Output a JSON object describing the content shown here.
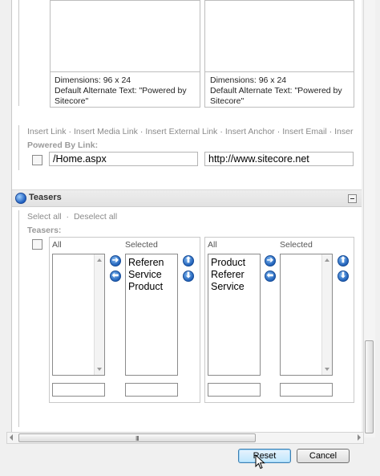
{
  "images": [
    {
      "dimensions": "Dimensions: 96 x 24",
      "alt_line1": "Default Alternate Text: \"Powered by",
      "alt_line2": "Sitecore\""
    },
    {
      "dimensions": "Dimensions: 96 x 24",
      "alt_line1": "Default Alternate Text: \"Powered by",
      "alt_line2": "Sitecore\""
    }
  ],
  "link_toolbar": {
    "items": [
      "Insert Link",
      "Insert Media Link",
      "Insert External Link",
      "Insert Anchor",
      "Insert Email",
      "Inser"
    ],
    "separator": "·"
  },
  "powered_by": {
    "label": "Powered By Link:",
    "path_value": "/Home.aspx",
    "url_value": "http://www.sitecore.net"
  },
  "teasers_section": {
    "title": "Teasers",
    "select_all": "Select all",
    "deselect_all": "Deselect all",
    "field_label": "Teasers:",
    "left_panel": {
      "all_label": "All",
      "selected_label": "Selected",
      "all_items": [],
      "selected_items": [
        "Referen",
        "Service",
        "Product"
      ]
    },
    "right_panel": {
      "all_label": "All",
      "selected_label": "Selected",
      "all_items": [
        "Product",
        "Referer",
        "Service"
      ],
      "selected_items": []
    }
  },
  "horizontal_scroll_grip": "III",
  "buttons": {
    "reset": "Reset",
    "cancel": "Cancel"
  },
  "colors": {
    "accent_blue": "#1b5cb5",
    "header_bg": "#e6e6e6",
    "muted_text": "#8a8a8a"
  }
}
